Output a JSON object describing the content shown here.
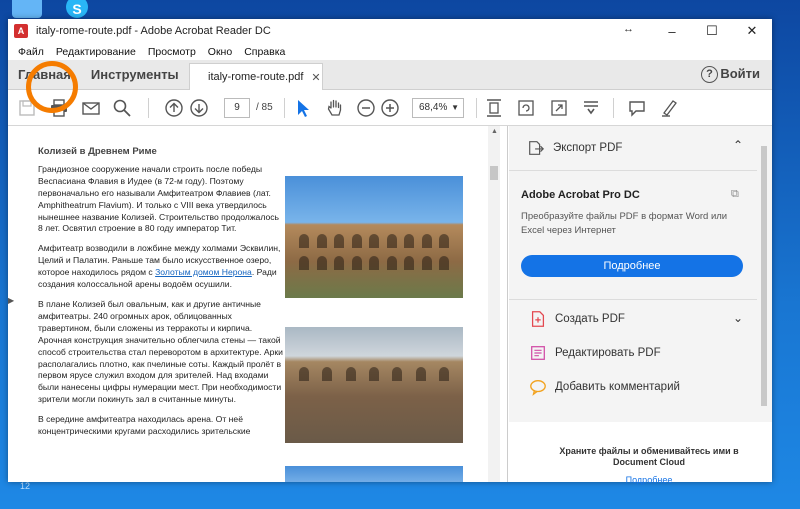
{
  "window": {
    "title": "italy-rome-route.pdf - Adobe Acrobat Reader DC",
    "controls": [
      "–",
      "☐",
      "✕"
    ]
  },
  "menu": [
    "Файл",
    "Редактирование",
    "Просмотр",
    "Окно",
    "Справка"
  ],
  "tabs": {
    "home": "Главная",
    "tools": "Инструменты",
    "document": "italy-rome-route.pdf",
    "login": "Войти"
  },
  "toolbar": {
    "current_page": "9",
    "total_pages": "/ 85",
    "zoom": "68,4%"
  },
  "document": {
    "heading": "Колизей в Древнем Риме",
    "paragraphs": [
      "Грандиозное сооружение начали строить после победы Веспасиана Флавия в Иудее (в 72-м году). Поэтому первоначально его называли Амфитеатром Флавиев (лат. Amphitheatrum Flavium). И только с VIII века утвердилось нынешнее название Колизей. Строительство продолжалось 8 лет. Освятил строение в 80 году император Тит.",
      "Амфитеатр возводили в ложбине между холмами Эсквилин, Целий и Палатин. Раньше там было искусственное озеро, которое находилось рядом с",
      "Золотым домом Нерона",
      ". Ради создания колоссальной арены водоём осушили.",
      "В плане Колизей был овальным, как и другие античные амфитеатры. 240 огромных арок, облицованных травертином, были сложены из терракоты и кирпича. Арочная конструкция значительно облегчила стены — такой способ строительства стал переворотом в архитектуре. Арки располагались плотно, как пчелиные соты. Каждый пролёт в первом ярусе служил входом для зрителей. Над входами были нанесены цифры нумерации мест. При необходимости зрители могли покинуть зал в считанные минуты.",
      "В середине амфитеатра находилась арена. От неё концентрическими кругами расходились зрительские"
    ]
  },
  "side_panel": {
    "export": "Экспорт PDF",
    "pro_title": "Adobe Acrobat Pro DC",
    "pro_desc": "Преобразуйте файлы PDF в формат Word или Excel через Интернет",
    "pro_button": "Подробнее",
    "tools": [
      "Создать PDF",
      "Редактировать PDF",
      "Добавить комментарий"
    ],
    "cloud_title": "Храните файлы и обменивайтесь ими в Document Cloud",
    "cloud_link": "Подробнее"
  },
  "desktop": {
    "corner_number": "12"
  },
  "colors": {
    "accent": "#1473e6",
    "highlight": "#f57c00",
    "select_tool": "#1473e6"
  }
}
